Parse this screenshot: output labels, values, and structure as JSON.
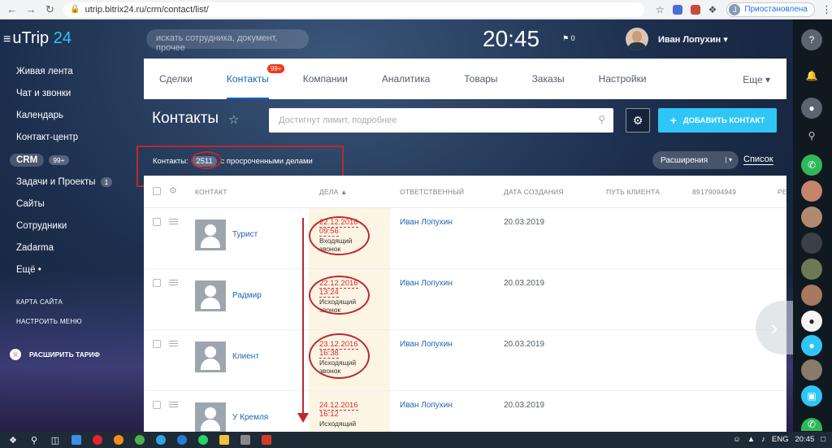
{
  "browser": {
    "url": "utrip.bitrix24.ru/crm/contact/list/",
    "profile_initial": "J",
    "profile_status": "Приостановлена"
  },
  "header": {
    "logo_text": "uTrip",
    "logo_num": "24",
    "search_placeholder": "искать сотрудника, документ, прочее",
    "clock": "20:45",
    "flag_count": "0",
    "user_name": "Иван Лопухин"
  },
  "left_menu": {
    "items": [
      {
        "label": "Живая лента"
      },
      {
        "label": "Чат и звонки"
      },
      {
        "label": "Календарь"
      },
      {
        "label": "Контакт-центр"
      },
      {
        "label": "CRM",
        "badge": "99+"
      },
      {
        "label": "Задачи и Проекты",
        "badge": "1"
      },
      {
        "label": "Сайты"
      },
      {
        "label": "Сотрудники"
      },
      {
        "label": "Zadarma"
      },
      {
        "label": "Ещё"
      }
    ],
    "site_map": "КАРТА САЙТА",
    "configure_menu": "НАСТРОИТЬ МЕНЮ",
    "upgrade": "РАСШИРИТЬ ТАРИФ"
  },
  "tabs": {
    "items": [
      "Сделки",
      "Контакты",
      "Компании",
      "Аналитика",
      "Товары",
      "Заказы",
      "Настройки"
    ],
    "active": "Контакты",
    "contacts_badge": "99+",
    "more": "Еще"
  },
  "toolbar": {
    "title": "Контакты",
    "filter_placeholder": "Достигнут лимит, подробнее",
    "add_label": "ДОБАВИТЬ КОНТАКТ",
    "counter_prefix": "Контакты:",
    "counter_value": "2511",
    "counter_suffix": "с просроченными делами",
    "extensions": "Расширения",
    "list_view": "Список"
  },
  "grid": {
    "headers": {
      "contact": "КОНТАКТ",
      "deals": "ДЕЛА",
      "responsible": "ОТВЕТСТВЕННЫЙ",
      "created": "ДАТА СОЗДАНИЯ",
      "journey": "ПУТЬ КЛИЕНТА",
      "phone": "89179094949",
      "extra": "РЕ"
    },
    "rows": [
      {
        "name": "Турист",
        "deal_date": "22.12.2016",
        "deal_time": "09:56",
        "deal_type": "Входящий звонок",
        "responsible": "Иван Лопухин",
        "created": "20.03.2019"
      },
      {
        "name": "Радмир",
        "deal_date": "22.12.2016",
        "deal_time": "13:24",
        "deal_type": "Исходящий звонок",
        "responsible": "Иван Лопухин",
        "created": "20.03.2019"
      },
      {
        "name": "Клиент",
        "deal_date": "23.12.2016",
        "deal_time": "16:38",
        "deal_type": "Исходящий звонок",
        "responsible": "Иван Лопухин",
        "created": "20.03.2019"
      },
      {
        "name": "У Кремля",
        "deal_date": "24.12.2016",
        "deal_time": "16:12",
        "deal_type": "Исходящий",
        "responsible": "Иван Лопухин",
        "created": "20.03.2019"
      }
    ]
  },
  "taskbar": {
    "lang": "ENG",
    "time": "20:45"
  },
  "colors": {
    "accent": "#2fc6f6",
    "link": "#2066b0",
    "annotation_red": "#c0272d",
    "overdue_red": "#d32f2f"
  }
}
